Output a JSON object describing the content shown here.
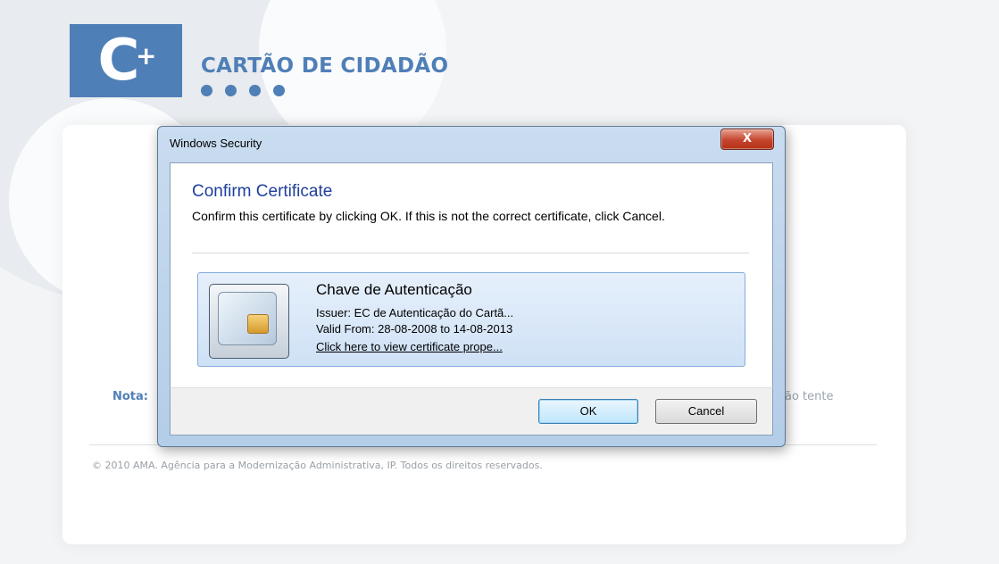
{
  "site": {
    "brand": "CARTÃO DE CIDADÃO",
    "logo_c": "C",
    "logo_plus": "+",
    "nota_label": "Nota:",
    "nota_tail": "ão tente",
    "footer": "© 2010 AMA. Agência para a Modernização Administrativa, IP. Todos os direitos reservados.",
    "brand_color": "#4f7fb7"
  },
  "dialog": {
    "window_title": "Windows Security",
    "close_label": "X",
    "heading": "Confirm Certificate",
    "message": "Confirm this certificate by clicking OK. If this is not the correct certificate, click Cancel.",
    "certificate": {
      "name": "Chave de Autenticação",
      "issuer": "Issuer: EC de Autenticação do Cartã...",
      "valid": "Valid From: 28-08-2008 to 14-08-2013",
      "link": "Click here to view certificate prope...",
      "icon": "smart-card-icon"
    },
    "ok_label": "OK",
    "cancel_label": "Cancel"
  }
}
